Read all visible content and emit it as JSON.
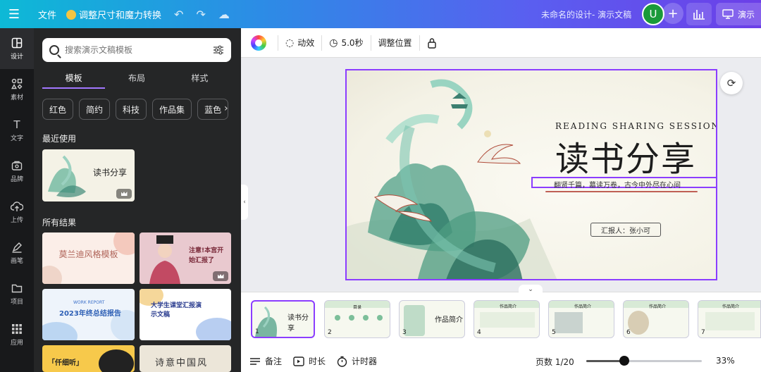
{
  "topbar": {
    "file_label": "文件",
    "resize_label": "调整尺寸和魔力转换",
    "doc_title": "未命名的设计- 演示文稿",
    "avatar_initial": "U",
    "present_label": "演示"
  },
  "rail": {
    "items": [
      {
        "label": "设计",
        "icon": "layout-icon"
      },
      {
        "label": "素材",
        "icon": "elements-icon"
      },
      {
        "label": "文字",
        "icon": "text-icon"
      },
      {
        "label": "品牌",
        "icon": "brand-icon"
      },
      {
        "label": "上传",
        "icon": "upload-icon"
      },
      {
        "label": "画笔",
        "icon": "draw-icon"
      },
      {
        "label": "项目",
        "icon": "folder-icon"
      },
      {
        "label": "应用",
        "icon": "apps-icon"
      }
    ]
  },
  "panel": {
    "search_placeholder": "搜索演示文稿模板",
    "tabs": [
      "模板",
      "布局",
      "样式"
    ],
    "chips": [
      "红色",
      "简约",
      "科技",
      "作品集",
      "蓝色"
    ],
    "recent_title": "最近使用",
    "results_title": "所有结果",
    "recent_thumb_title": "读书分享",
    "result_thumbs": [
      {
        "title": "莫兰迪风格模板"
      },
      {
        "title": "注意!本宫开始汇报了"
      },
      {
        "kicker": "WORK REPORT",
        "title": "2023年终总结报告"
      },
      {
        "title": "大学生课堂汇报演示文稿"
      },
      {
        "title": "「仟细听」"
      },
      {
        "title": "诗意中国风"
      }
    ]
  },
  "toolbar": {
    "animate_label": "动效",
    "duration_label": "5.0秒",
    "position_label": "调整位置"
  },
  "slide": {
    "english_title": "READING SHARING SESSION",
    "title": "读书分享",
    "subtitle": "翻贤千篇，墓读万卷，古今中外尽在心间",
    "reporter": "汇报人：张小可"
  },
  "pages": {
    "thumbs": [
      {
        "num": "1",
        "label": "读书分享"
      },
      {
        "num": "2",
        "label": "目录"
      },
      {
        "num": "3",
        "label": "作品简介"
      },
      {
        "num": "4",
        "label": "作品简介"
      },
      {
        "num": "5",
        "label": "作品简介"
      },
      {
        "num": "6",
        "label": "作品简介"
      },
      {
        "num": "7",
        "label": "作品简介"
      }
    ]
  },
  "bottombar": {
    "notes_label": "备注",
    "timing_label": "时长",
    "timer_label": "计时器",
    "page_counter": "页数 1/20",
    "zoom": "33%",
    "zoom_fraction": 0.33
  },
  "colors": {
    "accent": "#8b3dff",
    "topbar_start": "#0db9d6",
    "topbar_end": "#6c3fe8",
    "panel_bg": "#252627",
    "rail_bg": "#18191b"
  }
}
